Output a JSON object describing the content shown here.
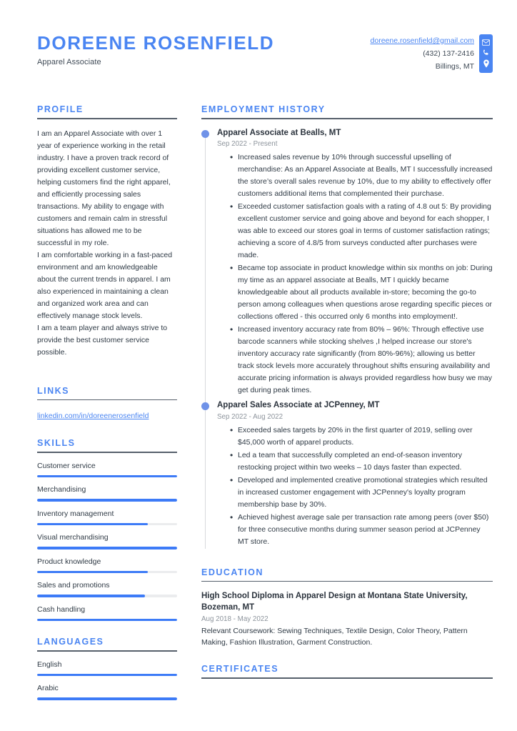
{
  "theme": {
    "accent": "#4a85f2",
    "bar_fill": "#3d7bf7",
    "bar_track": "#ebecee",
    "text": "#2f3a45",
    "muted": "#8d949c",
    "rule": "#56606b"
  },
  "header": {
    "name": "DOREENE ROSENFIELD",
    "job_title": "Apparel Associate",
    "email": "doreene.rosenfield@gmail.com",
    "phone": "(432) 137-2416",
    "location": "Billings, MT",
    "icons": [
      "envelope-icon",
      "phone-icon",
      "location-pin-icon"
    ]
  },
  "profile": {
    "heading": "PROFILE",
    "paragraphs": [
      "I am an Apparel Associate with over 1 year of experience working in the retail industry. I have a proven track record of providing excellent customer service, helping customers find the right apparel, and efficiently processing sales transactions. My ability to engage with customers and remain calm in stressful situations has allowed me to be successful in my role.",
      "I am comfortable working in a fast-paced environment and am knowledgeable about the current trends in apparel. I am also experienced in maintaining a clean and organized work area and can effectively manage stock levels.",
      "I am a team player and always strive to provide the best customer service possible."
    ]
  },
  "links": {
    "heading": "LINKS",
    "items": [
      {
        "label": "linkedin.com/in/doreenerosenfield"
      }
    ]
  },
  "skills": {
    "heading": "SKILLS",
    "items": [
      {
        "label": "Customer service",
        "level": 100
      },
      {
        "label": "Merchandising",
        "level": 100
      },
      {
        "label": "Inventory management",
        "level": 79
      },
      {
        "label": "Visual merchandising",
        "level": 100
      },
      {
        "label": "Product knowledge",
        "level": 79
      },
      {
        "label": "Sales and promotions",
        "level": 77
      },
      {
        "label": "Cash handling",
        "level": 100
      }
    ]
  },
  "languages": {
    "heading": "LANGUAGES",
    "items": [
      {
        "label": "English",
        "level": 100
      },
      {
        "label": "Arabic",
        "level": 100
      }
    ]
  },
  "employment": {
    "heading": "EMPLOYMENT HISTORY",
    "jobs": [
      {
        "title": "Apparel Associate at Bealls, MT",
        "dates": "Sep 2022 - Present",
        "achievements": [
          "Increased sales revenue by 10% through successful upselling of merchandise: As an Apparel Associate at Bealls, MT I successfully increased the store’s overall sales revenue by 10%, due to my ability to effectively offer customers additional items that complemented their purchase.",
          "Exceeded customer satisfaction goals with a rating of 4.8 out 5: By providing excellent customer service and going above and beyond for each shopper, I was able to exceed our stores goal in terms of customer satisfaction ratings; achieving a score of 4.8/5 from surveys conducted after purchases were made.",
          "Became top associate in product knowledge within six months on job: During my time as an apparel associate at Bealls, MT I quickly became knowledgeable about all products available in-store; becoming the go-to person among colleagues when questions arose regarding specific pieces or collections offered - this occurred only 6 months into employment!.",
          "Increased inventory accuracy rate from 80% – 96%: Through effective use barcode scanners while stocking shelves ,I helped increase our store's inventory accuracy rate significantly (from 80%-96%); allowing us better track stock levels more accurately throughout shifts ensuring availability and accurate pricing information is always provided regardless how busy we may get during peak times."
        ]
      },
      {
        "title": "Apparel Sales Associate at JCPenney, MT",
        "dates": "Sep 2022 - Aug 2022",
        "achievements": [
          "Exceeded sales targets by 20% in the first quarter of 2019, selling over $45,000 worth of apparel products.",
          "Led a team that successfully completed an end-of-season inventory restocking project within two weeks – 10 days faster than expected.",
          "Developed and implemented creative promotional strategies which resulted in increased customer engagement with JCPenney's loyalty program membership base by 30%.",
          "Achieved highest average sale per transaction rate among peers (over $50) for three consecutive months during summer season period at JCPenney MT store."
        ]
      }
    ]
  },
  "education": {
    "heading": "EDUCATION",
    "entries": [
      {
        "title": "High School Diploma in Apparel Design at Montana State University, Bozeman, MT",
        "dates": "Aug 2018 - May 2022",
        "description": "Relevant Coursework: Sewing Techniques, Textile Design, Color Theory, Pattern Making, Fashion Illustration, Garment Construction."
      }
    ]
  },
  "certificates": {
    "heading": "CERTIFICATES"
  }
}
